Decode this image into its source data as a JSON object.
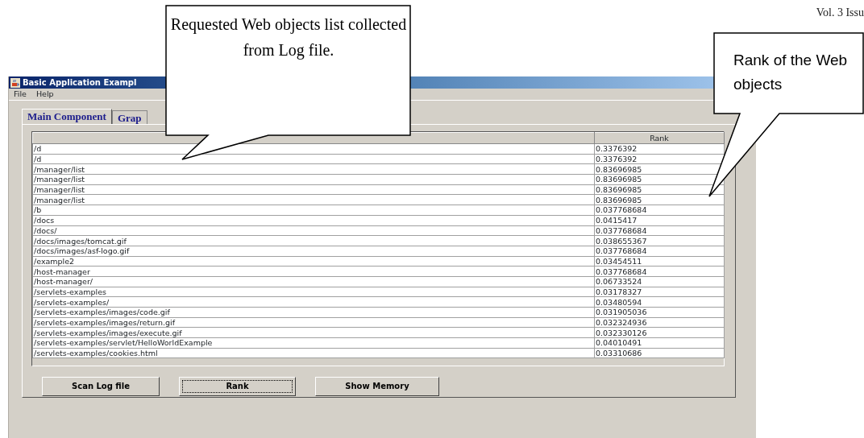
{
  "page_header": "Vol. 3 Issu",
  "window": {
    "title": "Basic Application Exampl"
  },
  "menu": [
    "File",
    "Help"
  ],
  "tabs": [
    {
      "label": "Main Component",
      "selected": true
    },
    {
      "label": "Grap",
      "selected": false
    }
  ],
  "table": {
    "rank_header": "Rank",
    "rows": [
      {
        "path": "/d",
        "rank": "0.3376392"
      },
      {
        "path": "/d",
        "rank": "0.3376392"
      },
      {
        "path": "/manager/list",
        "rank": "0.83696985"
      },
      {
        "path": "/manager/list",
        "rank": "0.83696985"
      },
      {
        "path": "/manager/list",
        "rank": "0.83696985"
      },
      {
        "path": "/manager/list",
        "rank": "0.83696985"
      },
      {
        "path": "/b",
        "rank": "0.037768684"
      },
      {
        "path": "/docs",
        "rank": "0.0415417"
      },
      {
        "path": "/docs/",
        "rank": "0.037768684"
      },
      {
        "path": "/docs/images/tomcat.gif",
        "rank": "0.038655367"
      },
      {
        "path": "/docs/images/asf-logo.gif",
        "rank": "0.037768684"
      },
      {
        "path": "/example2",
        "rank": "0.03454511"
      },
      {
        "path": "/host-manager",
        "rank": "0.037768684"
      },
      {
        "path": "/host-manager/",
        "rank": "0.06733524"
      },
      {
        "path": "/servlets-examples",
        "rank": "0.03178327"
      },
      {
        "path": "/servlets-examples/",
        "rank": "0.03480594"
      },
      {
        "path": "/servlets-examples/images/code.gif",
        "rank": "0.031905036"
      },
      {
        "path": "/servlets-examples/images/return.gif",
        "rank": "0.032324936"
      },
      {
        "path": "/servlets-examples/images/execute.gif",
        "rank": "0.032330126"
      },
      {
        "path": "/servlets-examples/servlet/HelloWorldExample",
        "rank": "0.04010491"
      },
      {
        "path": "/servlets-examples/cookies.html",
        "rank": "0.03310686"
      }
    ]
  },
  "buttons": [
    {
      "label": "Scan Log file",
      "focused": false
    },
    {
      "label": "Rank",
      "focused": true
    },
    {
      "label": "Show Memory",
      "focused": false
    }
  ],
  "callouts": [
    {
      "text": "Requested Web objects list collected from Log file."
    },
    {
      "text": "Rank of the Web objects"
    }
  ]
}
